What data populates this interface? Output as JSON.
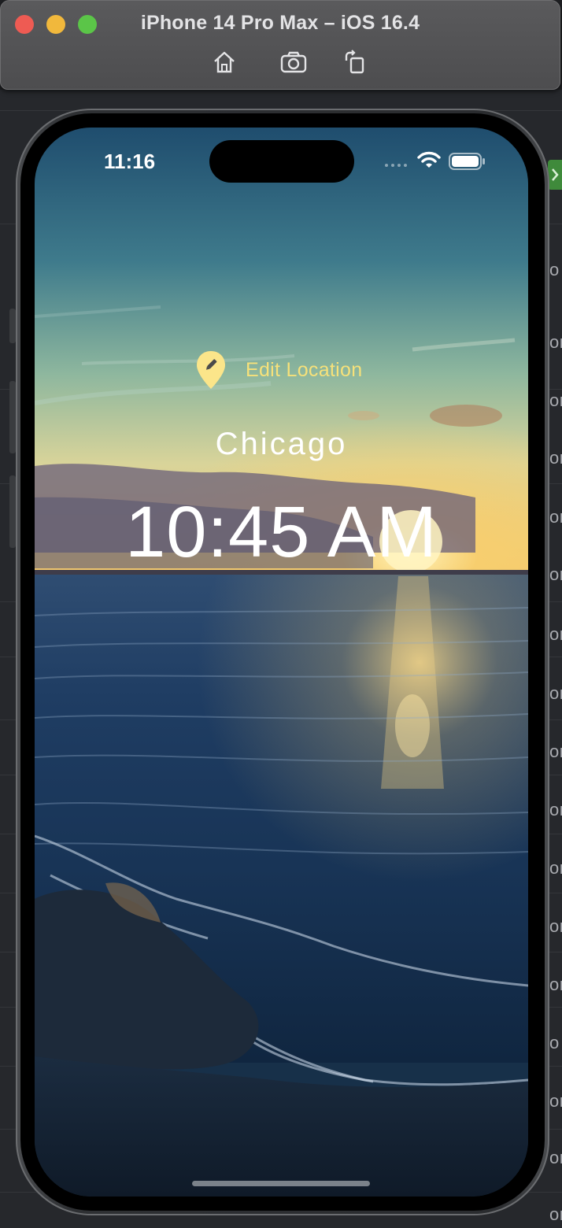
{
  "simulator": {
    "title": "iPhone 14 Pro Max – iOS 16.4",
    "toolbar": [
      {
        "name": "home",
        "icon": "home-icon"
      },
      {
        "name": "screenshot",
        "icon": "camera-icon"
      },
      {
        "name": "rotate",
        "icon": "rotate-icon"
      }
    ],
    "window_buttons": [
      "close",
      "minimize",
      "maximize"
    ]
  },
  "status_bar": {
    "time": "11:16",
    "wifi_icon": "wifi-icon",
    "battery_icon": "battery-icon"
  },
  "app": {
    "edit_location_label": "Edit Location",
    "edit_location_icon": "location-pin-edit-icon",
    "city": "Chicago",
    "time": "10:45 AM",
    "background": "sunset-beach-image"
  },
  "colors": {
    "edit_location": "#f6e17a",
    "pin": "#fbe58a",
    "text": "#ffffff",
    "traffic_close": "#ee5b53",
    "traffic_minimize": "#f1b83c",
    "traffic_maximize": "#5bc548"
  },
  "ide_edge_glyphs": [
    "o",
    "oı",
    "oı",
    "oı",
    "oı",
    "oı",
    "oı",
    "oı",
    "oı",
    "oı",
    "oı",
    "oı",
    "oı",
    "o",
    "oı",
    "oı",
    "oı"
  ]
}
